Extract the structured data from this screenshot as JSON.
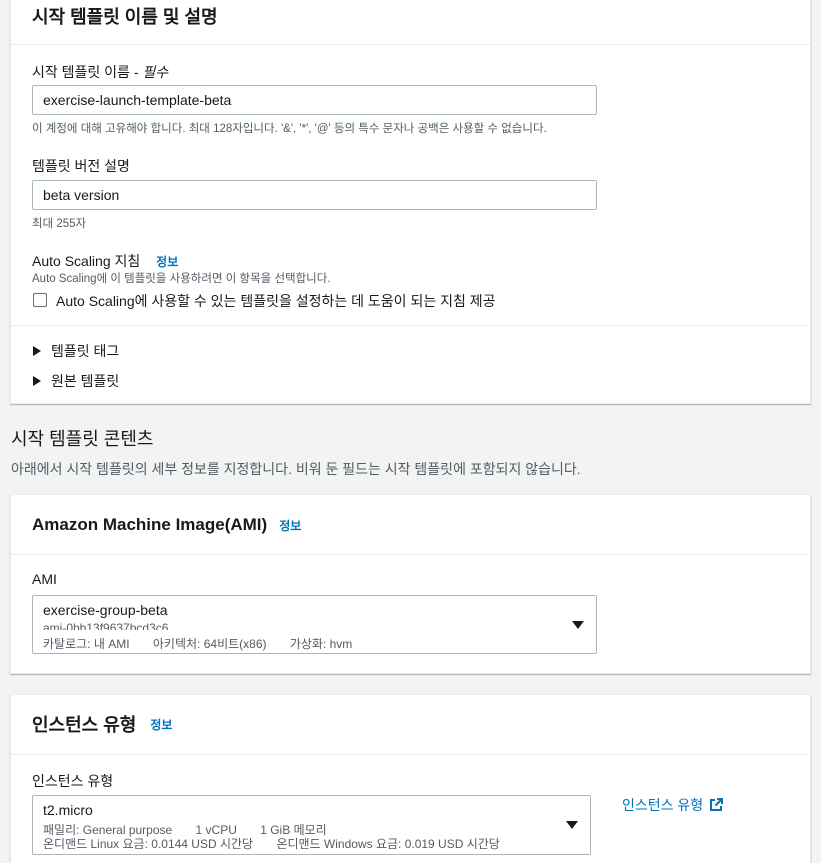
{
  "details": {
    "title": "시작 템플릿 이름 및 설명",
    "name_label": "시작 템플릿 이름 - ",
    "name_required": "필수",
    "name_value": "exercise-launch-template-beta",
    "name_hint": "이 계정에 대해 고유해야 합니다. 최대 128자입니다. '&', '*', '@' 등의 특수 문자나 공백은 사용할 수 없습니다.",
    "version_label": "템플릿 버전 설명",
    "version_value": "beta version",
    "version_hint": "최대 255자",
    "asg_label": "Auto Scaling 지침",
    "asg_info": "정보",
    "asg_desc": "Auto Scaling에 이 템플릿을 사용하려면 이 항목을 선택합니다.",
    "asg_checkbox_label": "Auto Scaling에 사용할 수 있는 템플릿을 설정하는 데 도움이 되는 지침 제공",
    "asg_checked": false,
    "expander_tags": "템플릿 태그",
    "expander_source": "원본 템플릿"
  },
  "contents": {
    "title": "시작 템플릿 콘텐츠",
    "desc": "아래에서 시작 템플릿의 세부 정보를 지정합니다. 비워 둔 필드는 시작 템플릿에 포함되지 않습니다."
  },
  "ami": {
    "title": "Amazon Machine Image(AMI)",
    "info": "정보",
    "label": "AMI",
    "selected_name": "exercise-group-beta",
    "selected_id": "ami-0bb13f9637bcd3c6",
    "catalog": "카탈로그: 내 AMI",
    "arch": "아키텍처: 64비트(x86)",
    "virt": "가상화: hvm"
  },
  "instance": {
    "title": "인스턴스 유형",
    "info": "정보",
    "label": "인스턴스 유형",
    "selected": "t2.micro",
    "family": "패밀리: General purpose",
    "vcpu": "1 vCPU",
    "memory": "1 GiB 메모리",
    "linux_price": "온디맨드 Linux 요금: 0.0144 USD 시간당",
    "windows_price": "온디맨드 Windows 요금: 0.019 USD 시간당",
    "link": "인스턴스 유형"
  },
  "colors": {
    "link": "#0073bb",
    "text": "#16191f",
    "muted": "#545b64",
    "background": "#f2f3f3"
  }
}
